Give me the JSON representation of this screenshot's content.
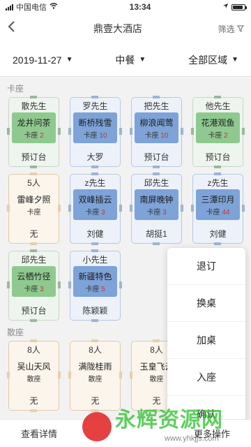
{
  "status": {
    "carrier": "中国电信",
    "time": "13:34",
    "battery_level": 0.85
  },
  "nav": {
    "title": "鼎壹大酒店",
    "filter_label": "筛选"
  },
  "filters": {
    "date": "2019-11-27",
    "meal": "中餐",
    "area": "全部区域"
  },
  "sections": [
    {
      "label": "卡座",
      "tables": [
        {
          "top": "散先生",
          "name": "龙井问茶",
          "type": "卡座",
          "count": "2",
          "bottom": "预订台",
          "style": "green"
        },
        {
          "top": "罗先生",
          "name": "断桥残雪",
          "type": "卡座",
          "count": "10",
          "bottom": "大罗",
          "style": "blue"
        },
        {
          "top": "把先生",
          "name": "柳浪闻莺",
          "type": "卡座",
          "count": "10",
          "bottom": "预订台",
          "style": "blue"
        },
        {
          "top": "他先生",
          "name": "花港观鱼",
          "type": "卡座",
          "count": "2",
          "bottom": "预订台",
          "style": "green"
        },
        {
          "top": "5人",
          "name": "雷峰夕照",
          "type": "卡座",
          "count": "",
          "bottom": "无",
          "style": "none"
        },
        {
          "top": "z先生",
          "name": "双峰插云",
          "type": "卡座",
          "count": "3",
          "bottom": "刘健",
          "style": "blue"
        },
        {
          "top": "邱先生",
          "name": "南屏晚钟",
          "type": "卡座",
          "count": "3",
          "bottom": "胡挺1",
          "style": "blue"
        },
        {
          "top": "z先生",
          "name": "三潭印月",
          "type": "卡座",
          "count": "44",
          "bottom": "刘健",
          "style": "blue"
        },
        {
          "top": "邱先生",
          "name": "云栖竹径",
          "type": "卡座",
          "count": "3",
          "bottom": "预订台",
          "style": "green"
        },
        {
          "top": "小先生",
          "name": "新疆特色",
          "type": "卡座",
          "count": "5",
          "bottom": "陈颖颖",
          "style": "blue"
        }
      ]
    },
    {
      "label": "散座",
      "tables": [
        {
          "top": "8人",
          "name": "吴山天风",
          "type": "散座",
          "count": "",
          "bottom": "无",
          "style": "none"
        },
        {
          "top": "8人",
          "name": "满陇桂雨",
          "type": "散座",
          "count": "",
          "bottom": "无",
          "style": "none"
        },
        {
          "top": "8人",
          "name": "玉皇飞云",
          "type": "散座",
          "count": "",
          "bottom": "无",
          "style": "none"
        }
      ]
    }
  ],
  "popup_menu": [
    "退订",
    "换桌",
    "加桌",
    "入座",
    "确认"
  ],
  "bottom": {
    "details_label": "查看详情",
    "more_label": "更多操作"
  },
  "watermark": {
    "text": "永辉资源网",
    "url": "www.yhkjjs.com"
  },
  "colors": {
    "green": "#8fc98f",
    "blue": "#7da3d8",
    "count_red": "#c0392b",
    "watermark_green": "#2cbf2c"
  }
}
